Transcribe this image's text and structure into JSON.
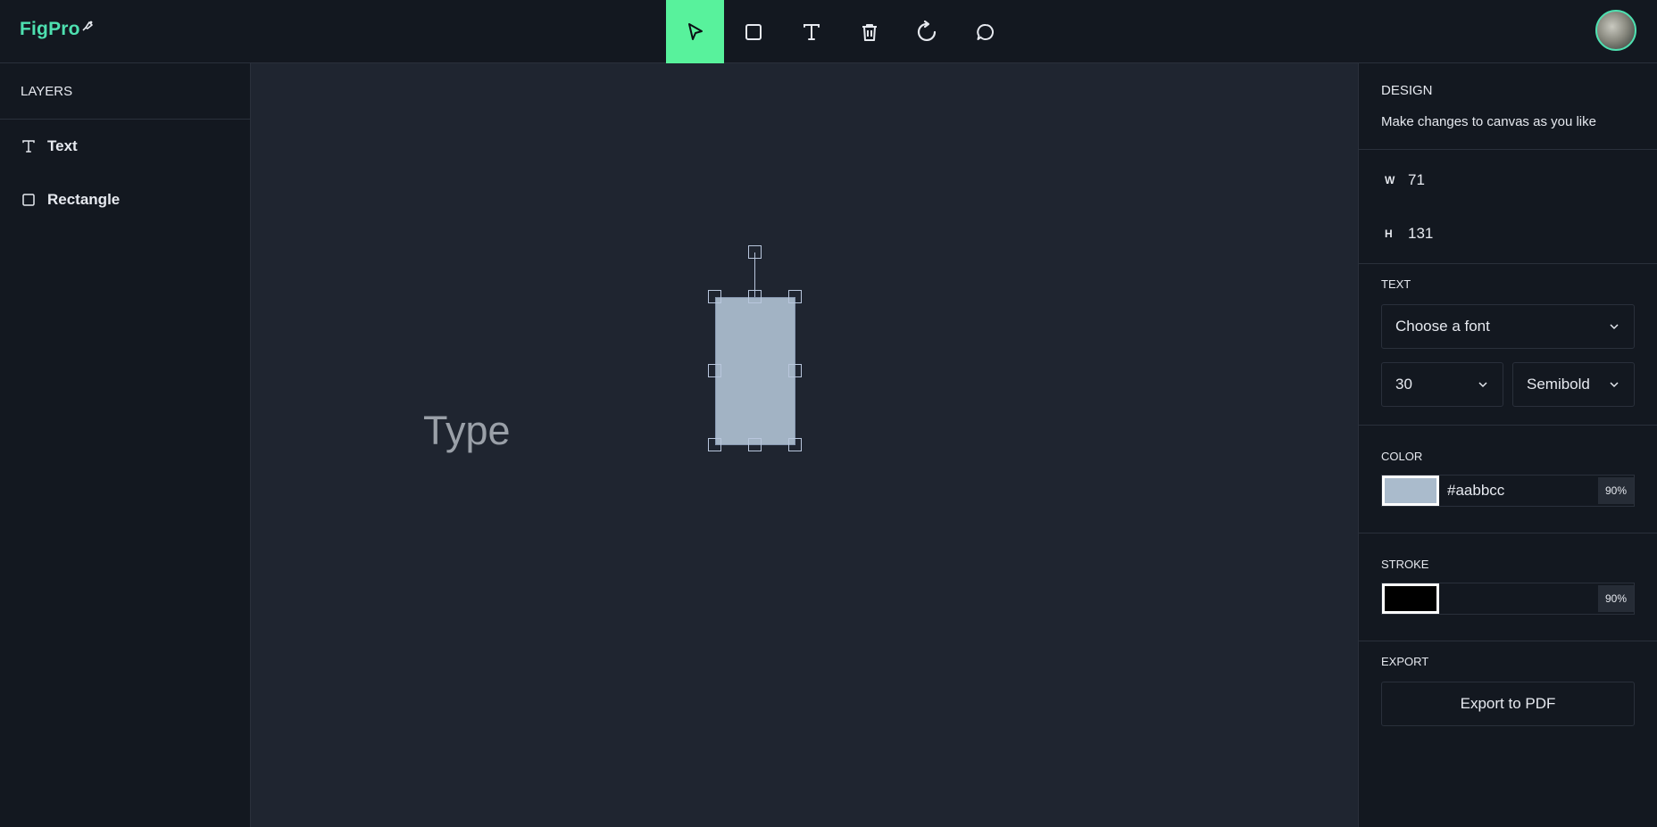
{
  "app": {
    "logo_text": "FigPro"
  },
  "toolbar": {
    "tools": [
      {
        "name": "select",
        "icon": "cursor-arrow-icon",
        "active": true
      },
      {
        "name": "rectangle",
        "icon": "square-icon",
        "active": false
      },
      {
        "name": "text",
        "icon": "text-t-icon",
        "active": false
      },
      {
        "name": "delete",
        "icon": "trash-icon",
        "active": false
      },
      {
        "name": "reset",
        "icon": "rotate-cw-icon",
        "active": false
      },
      {
        "name": "comments",
        "icon": "chat-bubble-icon",
        "active": false
      }
    ],
    "active_color": "#58f29c"
  },
  "layers": {
    "title": "LAYERS",
    "items": [
      {
        "label": "Text",
        "icon": "text-t-icon"
      },
      {
        "label": "Rectangle",
        "icon": "square-icon"
      }
    ]
  },
  "canvas": {
    "text_object": "Type",
    "rectangle_fill": "#aabbcc"
  },
  "design": {
    "title": "DESIGN",
    "subtitle": "Make changes to canvas as you like",
    "width_label": "W",
    "width_value": "71",
    "height_label": "H",
    "height_value": "131",
    "text_section": "TEXT",
    "font_placeholder": "Choose a font",
    "font_size": "30",
    "font_weight": "Semibold",
    "color_section": "COLOR",
    "fill_hex": "#aabbcc",
    "fill_opacity": "90%",
    "stroke_section": "STROKE",
    "stroke_color": "#000000",
    "stroke_opacity": "90%",
    "export_section": "EXPORT",
    "export_button": "Export to PDF"
  }
}
